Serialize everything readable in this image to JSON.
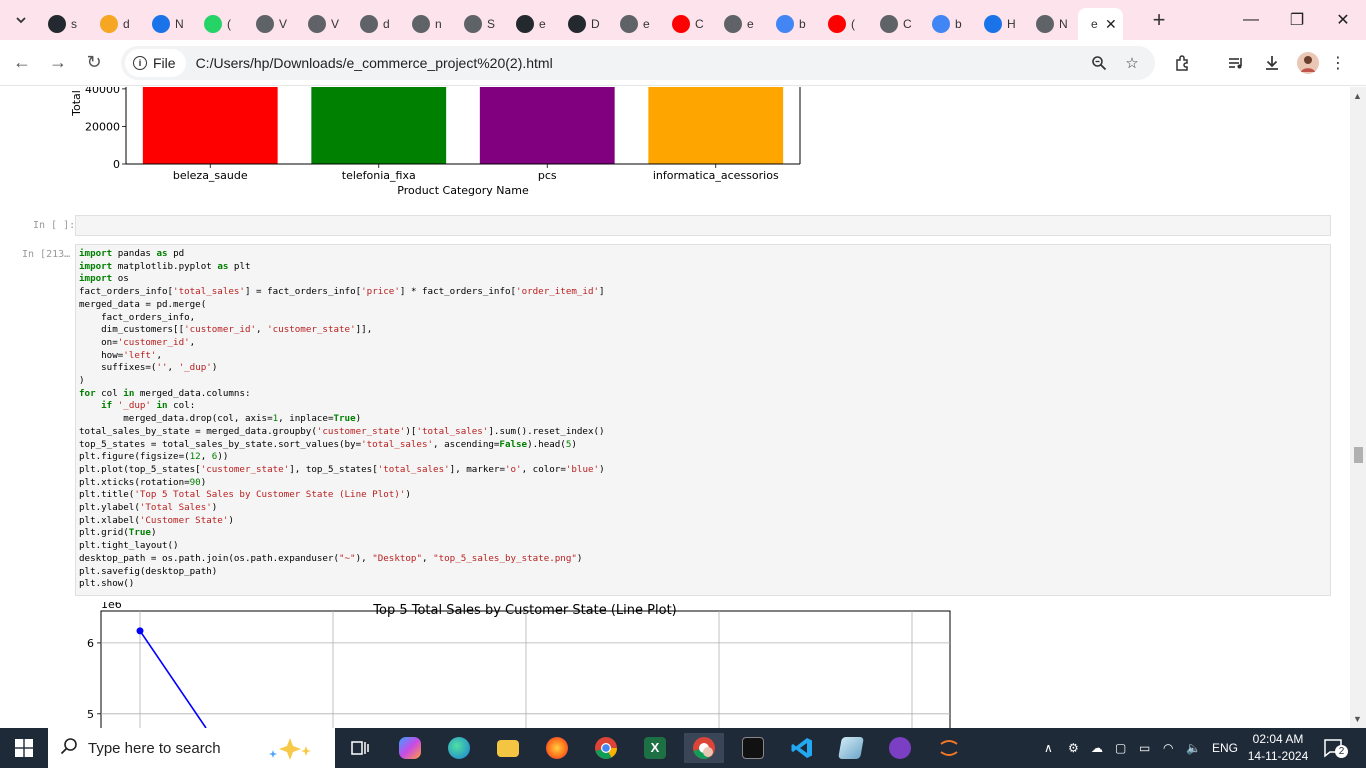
{
  "tabs": [
    {
      "letter": "s",
      "color": "#24292f",
      "glyph": "●"
    },
    {
      "letter": "d",
      "color": "#f5a623",
      "glyph": "●"
    },
    {
      "letter": "N",
      "color": "#1a73e8",
      "glyph": "●"
    },
    {
      "letter": "(",
      "color": "#25d366",
      "glyph": "●"
    },
    {
      "letter": "V",
      "color": "#5f6368",
      "glyph": "●"
    },
    {
      "letter": "V",
      "color": "#5f6368",
      "glyph": "●"
    },
    {
      "letter": "d",
      "color": "#5f6368",
      "glyph": "●"
    },
    {
      "letter": "n",
      "color": "#5f6368",
      "glyph": "●"
    },
    {
      "letter": "S",
      "color": "#5f6368",
      "glyph": "●"
    },
    {
      "letter": "e",
      "color": "#24292f",
      "glyph": "●"
    },
    {
      "letter": "D",
      "color": "#24292f",
      "glyph": "●"
    },
    {
      "letter": "e",
      "color": "#5f6368",
      "glyph": "●"
    },
    {
      "letter": "C",
      "color": "#ff0000",
      "glyph": "●"
    },
    {
      "letter": "e",
      "color": "#5f6368",
      "glyph": "●"
    },
    {
      "letter": "b",
      "color": "#4285f4",
      "glyph": "●"
    },
    {
      "letter": "(",
      "color": "#ff0000",
      "glyph": "●"
    },
    {
      "letter": "C",
      "color": "#5f6368",
      "glyph": "●"
    },
    {
      "letter": "b",
      "color": "#4285f4",
      "glyph": "●"
    },
    {
      "letter": "H",
      "color": "#1a73e8",
      "glyph": "●"
    },
    {
      "letter": "N",
      "color": "#5f6368",
      "glyph": "●"
    }
  ],
  "active_tab": {
    "letter": "e"
  },
  "window": {
    "minimize": "—",
    "restore": "❐",
    "close": "✕",
    "newtab": "+"
  },
  "toolbar": {
    "file_label": "File",
    "url": "C:/Users/hp/Downloads/e_commerce_project%20(2).html"
  },
  "notebook": {
    "empty_prompt": "In [ ]:",
    "code_prompt": "In [213…",
    "code_lines": [
      [
        [
          "kw",
          "import"
        ],
        [
          "t",
          " pandas "
        ],
        [
          "kw",
          "as"
        ],
        [
          "t",
          " pd"
        ]
      ],
      [
        [
          "kw",
          "import"
        ],
        [
          "t",
          " matplotlib.pyplot "
        ],
        [
          "kw",
          "as"
        ],
        [
          "t",
          " plt"
        ]
      ],
      [
        [
          "kw",
          "import"
        ],
        [
          "t",
          " os"
        ]
      ],
      [
        [
          "t",
          "fact_orders_info["
        ],
        [
          "str",
          "'total_sales'"
        ],
        [
          "t",
          "] = fact_orders_info["
        ],
        [
          "str",
          "'price'"
        ],
        [
          "t",
          "] * fact_orders_info["
        ],
        [
          "str",
          "'order_item_id'"
        ],
        [
          "t",
          "]"
        ]
      ],
      [
        [
          "t",
          "merged_data = pd.merge("
        ]
      ],
      [
        [
          "t",
          "    fact_orders_info,"
        ]
      ],
      [
        [
          "t",
          "    dim_customers[["
        ],
        [
          "str",
          "'customer_id'"
        ],
        [
          "t",
          ", "
        ],
        [
          "str",
          "'customer_state'"
        ],
        [
          "t",
          "]],"
        ]
      ],
      [
        [
          "t",
          "    on="
        ],
        [
          "str",
          "'customer_id'"
        ],
        [
          "t",
          ","
        ]
      ],
      [
        [
          "t",
          "    how="
        ],
        [
          "str",
          "'left'"
        ],
        [
          "t",
          ","
        ]
      ],
      [
        [
          "t",
          "    suffixes=("
        ],
        [
          "str",
          "''"
        ],
        [
          "t",
          ", "
        ],
        [
          "str",
          "'_dup'"
        ],
        [
          "t",
          ")"
        ]
      ],
      [
        [
          "t",
          ")"
        ]
      ],
      [
        [
          "kw",
          "for"
        ],
        [
          "t",
          " col "
        ],
        [
          "kw",
          "in"
        ],
        [
          "t",
          " merged_data.columns:"
        ]
      ],
      [
        [
          "t",
          "    "
        ],
        [
          "kw",
          "if"
        ],
        [
          "t",
          " "
        ],
        [
          "str",
          "'_dup'"
        ],
        [
          "t",
          " "
        ],
        [
          "kw",
          "in"
        ],
        [
          "t",
          " col:"
        ]
      ],
      [
        [
          "t",
          "        merged_data.drop(col, axis="
        ],
        [
          "num",
          "1"
        ],
        [
          "t",
          ", inplace="
        ],
        [
          "kw",
          "True"
        ],
        [
          "t",
          ")"
        ]
      ],
      [
        [
          "t",
          "total_sales_by_state = merged_data.groupby("
        ],
        [
          "str",
          "'customer_state'"
        ],
        [
          "t",
          ")["
        ],
        [
          "str",
          "'total_sales'"
        ],
        [
          "t",
          "].sum().reset_index()"
        ]
      ],
      [
        [
          "t",
          "top_5_states = total_sales_by_state.sort_values(by="
        ],
        [
          "str",
          "'total_sales'"
        ],
        [
          "t",
          ", ascending="
        ],
        [
          "kw",
          "False"
        ],
        [
          "t",
          ").head("
        ],
        [
          "num",
          "5"
        ],
        [
          "t",
          ")"
        ]
      ],
      [
        [
          "t",
          "plt.figure(figsize=("
        ],
        [
          "num",
          "12"
        ],
        [
          "t",
          ", "
        ],
        [
          "num",
          "6"
        ],
        [
          "t",
          "))"
        ]
      ],
      [
        [
          "t",
          "plt.plot(top_5_states["
        ],
        [
          "str",
          "'customer_state'"
        ],
        [
          "t",
          "], top_5_states["
        ],
        [
          "str",
          "'total_sales'"
        ],
        [
          "t",
          "], marker="
        ],
        [
          "str",
          "'o'"
        ],
        [
          "t",
          ", color="
        ],
        [
          "str",
          "'blue'"
        ],
        [
          "t",
          ")"
        ]
      ],
      [
        [
          "t",
          "plt.xticks(rotation="
        ],
        [
          "num",
          "90"
        ],
        [
          "t",
          ")"
        ]
      ],
      [
        [
          "t",
          "plt.title("
        ],
        [
          "str",
          "'Top 5 Total Sales by Customer State (Line Plot)'"
        ],
        [
          "t",
          ")"
        ]
      ],
      [
        [
          "t",
          "plt.ylabel("
        ],
        [
          "str",
          "'Total Sales'"
        ],
        [
          "t",
          ")"
        ]
      ],
      [
        [
          "t",
          "plt.xlabel("
        ],
        [
          "str",
          "'Customer State'"
        ],
        [
          "t",
          ")"
        ]
      ],
      [
        [
          "t",
          "plt.grid("
        ],
        [
          "kw",
          "True"
        ],
        [
          "t",
          ")"
        ]
      ],
      [
        [
          "t",
          "plt.tight_layout()"
        ]
      ],
      [
        [
          "t",
          "desktop_path = os.path.join(os.path.expanduser("
        ],
        [
          "str",
          "\"~\""
        ],
        [
          "t",
          "), "
        ],
        [
          "str",
          "\"Desktop\""
        ],
        [
          "t",
          ", "
        ],
        [
          "str",
          "\"top_5_sales_by_state.png\""
        ],
        [
          "t",
          ")"
        ]
      ],
      [
        [
          "t",
          "plt.savefig(desktop_path)"
        ]
      ],
      [
        [
          "t",
          "plt.show()"
        ]
      ]
    ]
  },
  "chart_data": [
    {
      "type": "bar",
      "categories": [
        "beleza_saude",
        "telefonia_fixa",
        "pcs",
        "informatica_acessorios"
      ],
      "colors": [
        "#ff0000",
        "#008000",
        "#800080",
        "#ffa500"
      ],
      "xlabel": "Product Category Name",
      "ylabel": "Total",
      "yticks": [
        0,
        20000,
        40000
      ],
      "ytick_labels": [
        "0",
        "20000",
        "40000"
      ],
      "visible_ylim": [
        0,
        41000
      ],
      "values_note_cropped_above": true
    },
    {
      "type": "line",
      "title": "Top 5 Total Sales by Customer State (Line Plot)",
      "offset_label": "1e6",
      "yticks": [
        5,
        6
      ],
      "ytick_labels": [
        "5",
        "6"
      ],
      "visible_ylim": [
        4.8,
        6.45
      ],
      "grid": true,
      "color": "#0000ff",
      "points": [
        {
          "x": 0,
          "y": 6.17
        }
      ],
      "segment_end": {
        "x": 0.35,
        "y": 4.8
      }
    }
  ],
  "taskbar": {
    "search_placeholder": "Type here to search",
    "lang": "ENG",
    "time": "02:04 AM",
    "date": "14-11-2024",
    "notifications": "2"
  }
}
